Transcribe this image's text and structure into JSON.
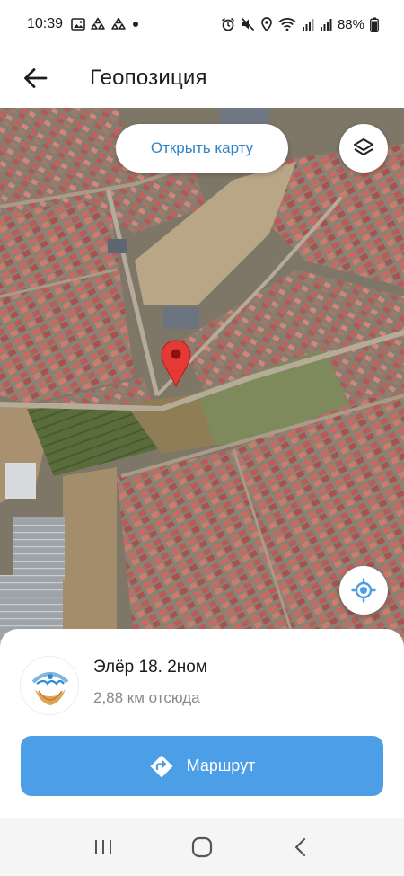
{
  "status_bar": {
    "time": "10:39",
    "battery": "88%",
    "left_icons": [
      "gallery-icon",
      "recycle-icon",
      "recycle-icon",
      "dot-icon"
    ],
    "right_icons": [
      "alarm-icon",
      "mute-icon",
      "location-icon",
      "wifi-icon",
      "signal-icon",
      "signal-icon",
      "battery-icon"
    ]
  },
  "app_bar": {
    "title": "Геопозиция",
    "back_icon": "arrow-left-icon"
  },
  "map": {
    "open_map_label": "Открыть карту",
    "layers_icon": "layers-icon",
    "locate_icon": "my-location-icon",
    "pin_icon": "map-pin-icon",
    "pin_color": "#e53935"
  },
  "place": {
    "name": "Элёр 18. 2ном",
    "distance": "2,88 км отсюда",
    "route_label": "Маршрут",
    "route_icon": "directions-icon"
  },
  "nav_bar": {
    "items": [
      "recent-apps-icon",
      "home-icon",
      "back-icon"
    ]
  },
  "colors": {
    "accent": "#4c9ee6",
    "link": "#2f84c9"
  }
}
